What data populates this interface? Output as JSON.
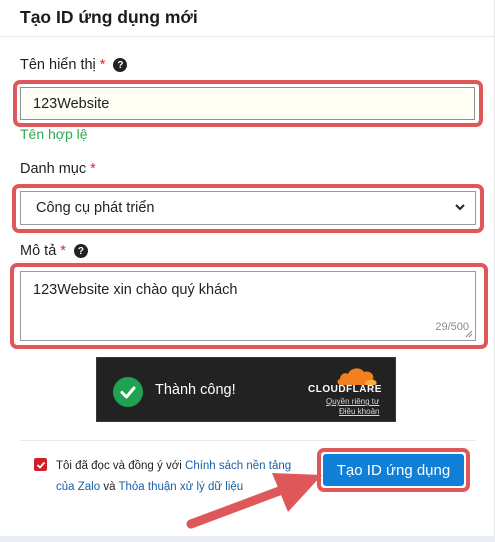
{
  "dialog": {
    "title": "Tạo ID ứng dụng mới"
  },
  "display_name": {
    "label": "Tên hiển thị",
    "required_mark": "*",
    "help_glyph": "?",
    "value": "123Website",
    "validation": "Tên hợp lệ"
  },
  "category": {
    "label": "Danh mục",
    "required_mark": "*",
    "selected": "Công cụ phát triển"
  },
  "description": {
    "label": "Mô tả",
    "required_mark": "*",
    "help_glyph": "?",
    "value": "123Website xin chào quý khách",
    "counter": "29/500"
  },
  "captcha": {
    "status": "Thành công!",
    "brand": "CLOUDFLARE",
    "privacy_link": "Quyền riêng tư",
    "terms_link": "Điều khoản"
  },
  "agreement": {
    "checked": true,
    "text_before": "Tôi đã đọc và đồng ý với",
    "link1": "Chính sách nền tảng của Zalo",
    "text_middle": "và",
    "link2": "Thỏa thuận xử lý dữ liệu"
  },
  "submit": {
    "label": "Tạo ID ứng dụng"
  },
  "colors": {
    "highlight": "#e0575a",
    "primary": "#0f7fd8",
    "valid": "#2fa84f",
    "required": "#e0262c",
    "cloudflare_orange": "#f38020"
  }
}
